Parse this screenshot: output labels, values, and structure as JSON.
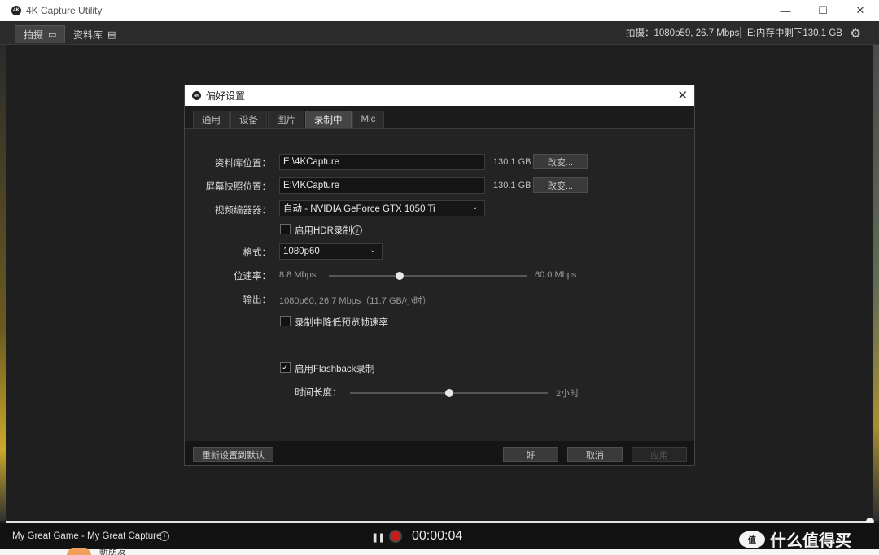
{
  "window": {
    "title": "4K Capture Utility",
    "logo_text": "4K",
    "controls": {
      "minimize": "—",
      "maximize": "☐",
      "close": "✕"
    }
  },
  "toolbar": {
    "tabs": [
      {
        "label": "拍摄",
        "icon": "screen-icon",
        "active": true
      },
      {
        "label": "资料库",
        "icon": "library-icon",
        "active": false
      }
    ],
    "capture_status": "拍摄：1080p59, 26.7 Mbps",
    "storage_status": "E:内存中剩下130.1 GB",
    "settings_icon": "gear-icon"
  },
  "dialog": {
    "title": "偏好设置",
    "logo_text": "4K",
    "close_label": "✕",
    "tabs": [
      "通用",
      "设备",
      "图片",
      "录制中",
      "Mic"
    ],
    "active_tab": "录制中",
    "library_location": {
      "label": "资料库位置：",
      "value": "E:\\4KCapture",
      "size": "130.1 GB",
      "button": "改变..."
    },
    "snapshot_location": {
      "label": "屏幕快照位置：",
      "value": "E:\\4KCapture",
      "size": "130.1 GB",
      "button": "改变..."
    },
    "video_encoder": {
      "label": "视频编器器：",
      "value": "自动 - NVIDIA GeForce GTX 1050 Ti"
    },
    "hdr": {
      "label": "启用HDR录制",
      "checked": false
    },
    "format": {
      "label": "格式：",
      "value": "1080p60"
    },
    "bitrate": {
      "label": "位速率：",
      "min": "8.8 Mbps",
      "max": "60.0 Mbps",
      "level": 0.36
    },
    "output": {
      "label": "输出：",
      "value": "1080p60, 26.7 Mbps（11.7 GB/小时）"
    },
    "reduce_preview": {
      "label": "录制中降低预览帧速率",
      "checked": false
    },
    "flashback": {
      "label": "启用Flashback录制",
      "checked": true
    },
    "duration": {
      "label": "时间长度：",
      "max": "2小时",
      "level": 0.5
    },
    "footer": {
      "reset": "重新设置到默认",
      "ok": "好",
      "cancel": "取消",
      "apply": "应用"
    }
  },
  "bottom_bar": {
    "capture_name": "My Great Game - My Great Capture",
    "timer": "00:00:04",
    "progress": 1.0
  },
  "watermark": {
    "logo": "值",
    "text": "什么值得买"
  },
  "below": {
    "text": "新朋友"
  }
}
